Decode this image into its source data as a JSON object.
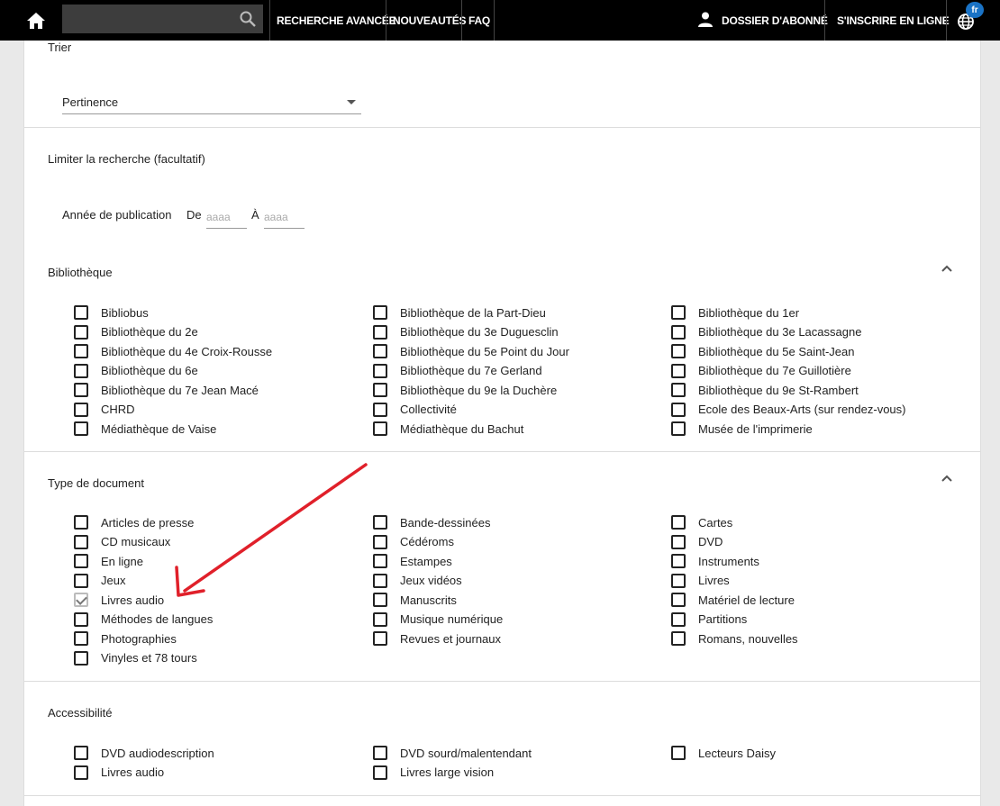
{
  "topbar": {
    "search_value": "",
    "nav": {
      "advanced": "RECHERCHE AVANCÉE",
      "news": "NOUVEAUTÉS",
      "faq": "FAQ",
      "account": "DOSSIER D'ABONNÉ",
      "register": "S'INSCRIRE EN LIGNE"
    },
    "lang_badge": "fr"
  },
  "sort": {
    "title": "Trier",
    "selected": "Pertinence"
  },
  "limit": {
    "title": "Limiter la recherche (facultatif)",
    "year_label": "Année de publication",
    "from_label": "De",
    "to_label": "À",
    "from_placeholder": "aaaa",
    "to_placeholder": "aaaa"
  },
  "library": {
    "title": "Bibliothèque",
    "col1": [
      "Bibliobus",
      "Bibliothèque du 2e",
      "Bibliothèque du 4e Croix-Rousse",
      "Bibliothèque du 6e",
      "Bibliothèque du 7e Jean Macé",
      "CHRD",
      "Médiathèque de Vaise"
    ],
    "col2": [
      "Bibliothèque de la Part-Dieu",
      "Bibliothèque du 3e Duguesclin",
      "Bibliothèque du 5e Point du Jour",
      "Bibliothèque du 7e Gerland",
      "Bibliothèque du 9e la Duchère",
      "Collectivité",
      "Médiathèque du Bachut"
    ],
    "col3": [
      "Bibliothèque du 1er",
      "Bibliothèque du 3e Lacassagne",
      "Bibliothèque du 5e Saint-Jean",
      "Bibliothèque du 7e Guillotière",
      "Bibliothèque du 9e St-Rambert",
      "Ecole des Beaux-Arts (sur rendez-vous)",
      "Musée de l'imprimerie"
    ]
  },
  "doctype": {
    "title": "Type de document",
    "col1": [
      "Articles de presse",
      "CD musicaux",
      "En ligne",
      "Jeux",
      "Livres audio",
      "Méthodes de langues",
      "Photographies",
      "Vinyles et 78 tours"
    ],
    "col2": [
      "Bande-dessinées",
      "Cédéroms",
      "Estampes",
      "Jeux vidéos",
      "Manuscrits",
      "Musique numérique",
      "Revues et journaux"
    ],
    "col3": [
      "Cartes",
      "DVD",
      "Instruments",
      "Livres",
      "Matériel de lecture",
      "Partitions",
      "Romans, nouvelles"
    ],
    "checked": "Livres audio"
  },
  "access": {
    "title": "Accessibilité",
    "col1": [
      "DVD audiodescription",
      "Livres audio"
    ],
    "col2": [
      "DVD sourd/malentendant",
      "Livres large vision"
    ],
    "col3": [
      "Lecteurs Daisy"
    ]
  },
  "colors": {
    "topbar": "#000000",
    "badge": "#1a73c6",
    "annotation_arrow": "#e0202a"
  }
}
